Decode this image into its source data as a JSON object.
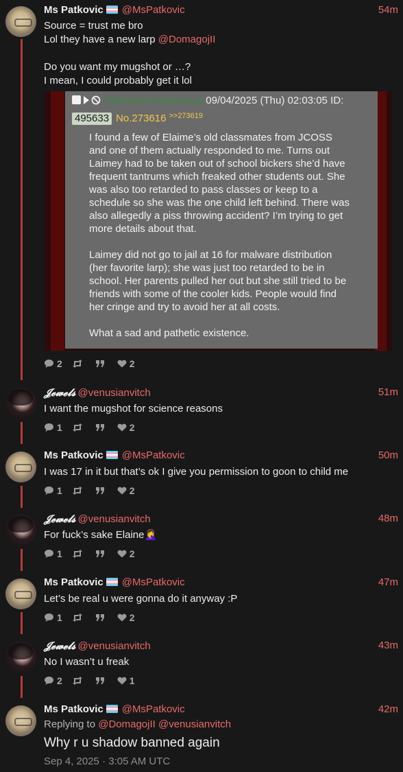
{
  "posts": [
    {
      "name": "Ms Patkovic",
      "handle": "@MsPatkovic",
      "time": "54m",
      "text_line1": "Source = trust me bro",
      "text_line2_prefix": "Lol they have a new larp ",
      "text_line2_mention": "@DomagojII",
      "text_line3": "Do you want my mugshot or …?",
      "text_line4": "I mean, I could probably get it lol",
      "stats": {
        "replies": "2",
        "likes": "2"
      }
    },
    {
      "name": "𝓙𝓮𝔀𝓮𝓵𝓼",
      "handle": "@venusianvitch",
      "time": "51m",
      "text": "I want the mugshot for science reasons",
      "stats": {
        "replies": "1",
        "likes": "2"
      }
    },
    {
      "name": "Ms Patkovic",
      "handle": "@MsPatkovic",
      "time": "50m",
      "text": "I was 17 in it but that’s ok I give you permission to goon to child me",
      "stats": {
        "replies": "1",
        "likes": "2"
      }
    },
    {
      "name": "𝓙𝓮𝔀𝓮𝓵𝓼",
      "handle": "@venusianvitch",
      "time": "48m",
      "text": "For fuck’s sake Elaine🤦‍♀️",
      "stats": {
        "replies": "1",
        "likes": "2"
      }
    },
    {
      "name": "Ms Patkovic",
      "handle": "@MsPatkovic",
      "time": "47m",
      "text": "Let’s be real u were gonna do it anyway :P",
      "stats": {
        "replies": "1",
        "likes": "2"
      }
    },
    {
      "name": "𝓙𝓮𝔀𝓮𝓵𝓼",
      "handle": "@venusianvitch",
      "time": "43m",
      "text": "No I wasn’t u freak",
      "stats": {
        "replies": "2",
        "likes": "1"
      }
    },
    {
      "name": "Ms Patkovic",
      "handle": "@MsPatkovic",
      "time": "42m",
      "replying_label": "Replying to ",
      "replying_mention1": "@DomagojII",
      "replying_mention2": "@venusianvitch",
      "text": "Why r u shadow banned again",
      "date": "Sep 4, 2025 · 3:05 AM UTC"
    }
  ],
  "quote": {
    "hidden_name": "Unknown Anonymous",
    "datetime": "09/04/2025 (Thu) 02:03:05 ID:",
    "id": "495633",
    "post_no": "No.273616",
    "post_link": ">>273619",
    "body": "I found a few of Elaime’s old classmates from JCOSS and one of them actually responded to me. Turns out Laimey had to be taken out of school bickers she’d have frequent tantrums which freaked other students out. She was also too retarded to pass classes or keep to a schedule so she was the one child left behind. There was also allegedly a piss throwing accident? I’m trying to get more details about that.\n\nLaimey did not go to jail at 16 for malware distribution (her favorite larp); she was just too retarded to be in school. Her parents pulled her out but she still tried to be friends with some of the cooler kids. People would find her cringe and try to avoid her at all costs.\n\nWhat a sad and pathetic existence."
  },
  "icons": {
    "reply": "comment-icon",
    "retweet": "retweet-icon",
    "quote": "quote-icon",
    "like": "heart-icon"
  },
  "colors": {
    "accent": "#e86a6a",
    "background": "#181818",
    "thread_line": "#b33a3a"
  }
}
